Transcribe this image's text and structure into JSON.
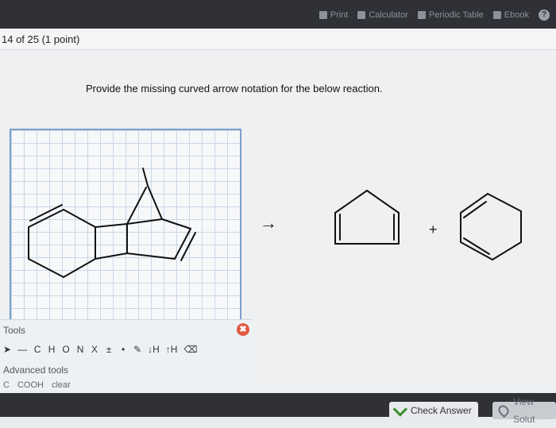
{
  "topbar": {
    "items": [
      {
        "label": "Print"
      },
      {
        "label": "Calculator"
      },
      {
        "label": "Periodic Table"
      },
      {
        "label": "Ebook"
      }
    ],
    "help_label": "?"
  },
  "question": {
    "number_label": "14 of 25 (1 point)",
    "prompt": "Provide the missing curved arrow notation for the below reaction."
  },
  "reaction": {
    "arrow_symbol": "→",
    "plus_symbol": "+"
  },
  "tools": {
    "title": "Tools",
    "close_symbol": "✖",
    "row": [
      "C",
      "H",
      "O",
      "N",
      "X"
    ],
    "hplus": "↓H",
    "hminus": "↑H",
    "advanced_label": "Advanced tools",
    "row3": [
      "C",
      "COOH",
      "clear"
    ]
  },
  "buttons": {
    "check_answer": "Check Answer",
    "view_solution": "View Solut"
  }
}
